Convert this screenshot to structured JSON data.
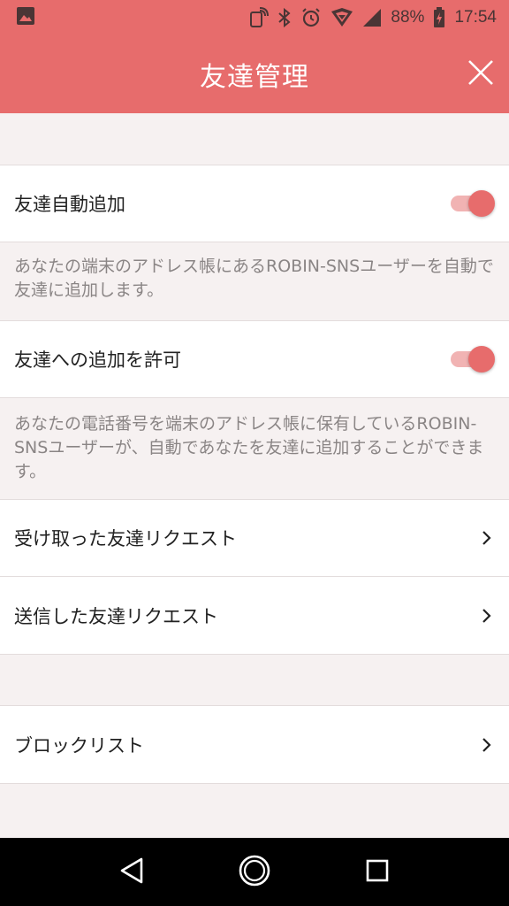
{
  "status_bar": {
    "battery": "88%",
    "time": "17:54",
    "icons": [
      "image-icon",
      "nfc-icon",
      "bluetooth-icon",
      "alarm-icon",
      "wifi-icon",
      "signal-icon",
      "battery-icon"
    ]
  },
  "app_bar": {
    "title": "友達管理",
    "close_icon": "close-icon"
  },
  "settings": {
    "auto_add": {
      "label": "友達自動追加",
      "enabled": true,
      "description": "あなたの端末のアドレス帳にあるROBIN-SNSユーザーを自動で友達に追加します。"
    },
    "allow_add": {
      "label": "友達への追加を許可",
      "enabled": true,
      "description": "あなたの電話番号を端末のアドレス帳に保有しているROBIN-SNSユーザーが、自動であなたを友達に追加することができます。"
    },
    "received_requests": {
      "label": "受け取った友達リクエスト"
    },
    "sent_requests": {
      "label": "送信した友達リクエスト"
    },
    "block_list": {
      "label": "ブロックリスト"
    }
  },
  "nav_bar": {
    "icons": [
      "back-icon",
      "home-icon",
      "recents-icon"
    ]
  },
  "colors": {
    "accent": "#e76c6c",
    "toggle_track": "#f1b3b3",
    "background": "#f6f1f1",
    "description_text": "#8a8585"
  }
}
